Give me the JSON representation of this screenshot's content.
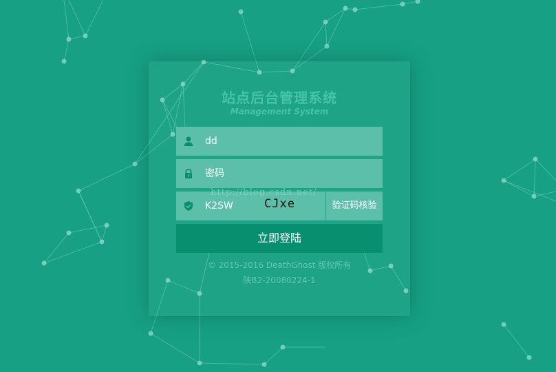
{
  "login": {
    "title": "站点后台管理系统",
    "subtitle": "Management System",
    "username_value": "dd",
    "password_placeholder": "密码",
    "captcha_input_value": "K2SW",
    "captcha_image_text": "CJxe",
    "verify_button_label": "验证码核验",
    "login_button_label": "立即登陆"
  },
  "footer": {
    "copyright": "© 2015-2016 DeathGhost 版权所有",
    "icp": "陕B2-20080224-1"
  },
  "watermark": "http://blog.csdn.net/",
  "icons": {
    "username": "user-icon",
    "password": "lock-icon",
    "captcha": "shield-check-icon"
  },
  "colors": {
    "background": "#17a084",
    "field": "#5cbfa9",
    "button": "#078f70",
    "title": "#46c3a8"
  }
}
